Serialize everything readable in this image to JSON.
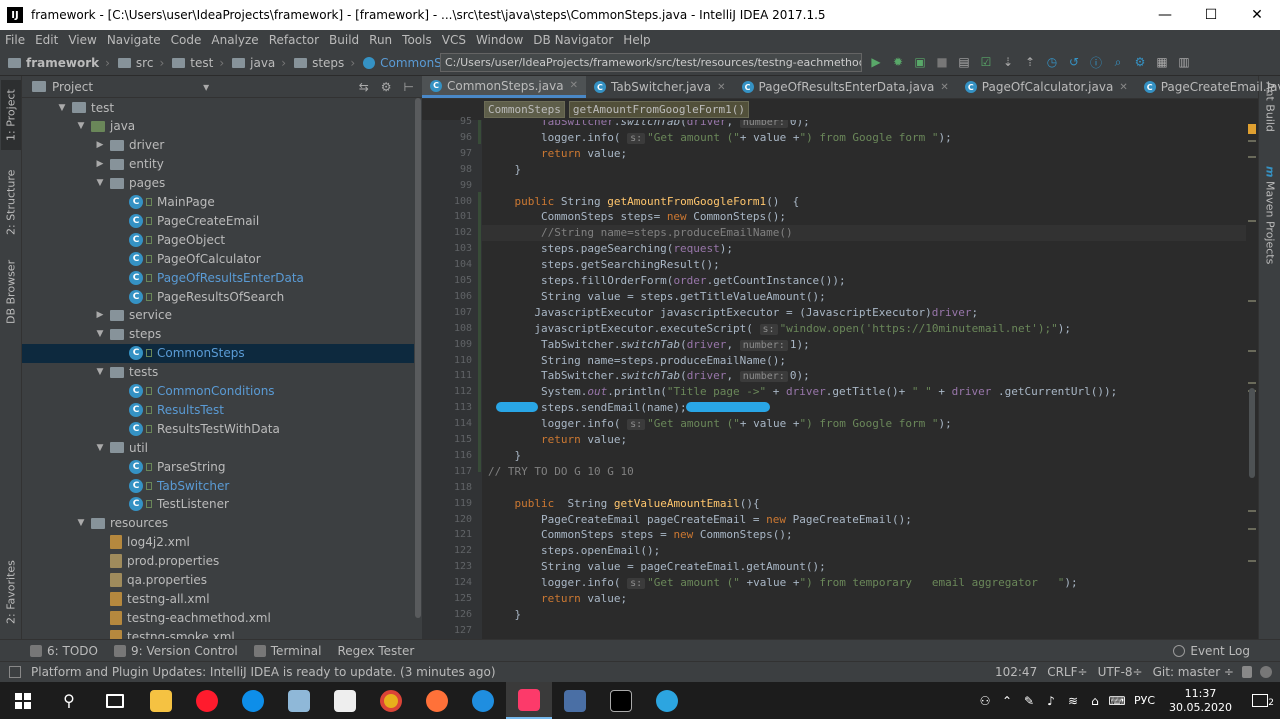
{
  "window": {
    "title": "framework - [C:\\Users\\user\\IdeaProjects\\framework] - [framework] - ...\\src\\test\\java\\steps\\CommonSteps.java - IntelliJ IDEA 2017.1.5",
    "minimize": "—",
    "maximize": "☐",
    "close": "✕"
  },
  "menu": [
    "File",
    "Edit",
    "View",
    "Navigate",
    "Code",
    "Analyze",
    "Refactor",
    "Build",
    "Run",
    "Tools",
    "VCS",
    "Window",
    "DB Navigator",
    "Help"
  ],
  "nav": {
    "crumbs": [
      "framework",
      "src",
      "test",
      "java",
      "steps",
      "CommonSteps"
    ],
    "path": "C:/Users/user/IdeaProjects/framework/src/test/resources/testng-eachmethod.xml",
    "path_arrow": "▾"
  },
  "toolbar_icons": [
    "run-icon",
    "debug-icon",
    "coverage-icon",
    "stop-icon",
    "build-icon",
    "check-icon",
    "commit-icon",
    "vcs-update-icon",
    "history-icon",
    "info-icon",
    "search-icon",
    "settings-icon",
    "module-icon",
    "layout-icon"
  ],
  "side_left": {
    "project": "1: Project",
    "structure": "2: Structure",
    "db": "DB Browser",
    "favorites": "2: Favorites"
  },
  "side_right": {
    "ant": "Ant Build",
    "maven": "Maven Projects",
    "maven_m": "m"
  },
  "project_panel": {
    "title": "Project",
    "dropdown": "▾",
    "icons": [
      "⇆",
      "⚙",
      "⊢"
    ]
  },
  "tree": [
    {
      "label": "test",
      "depth": 2,
      "type": "folder",
      "arrow": "▼"
    },
    {
      "label": "java",
      "depth": 3,
      "type": "srcfolder",
      "arrow": "▼"
    },
    {
      "label": "driver",
      "depth": 4,
      "type": "folder",
      "arrow": "▶"
    },
    {
      "label": "entity",
      "depth": 4,
      "type": "folder",
      "arrow": "▶"
    },
    {
      "label": "pages",
      "depth": 4,
      "type": "folder",
      "arrow": "▼"
    },
    {
      "label": "MainPage",
      "depth": 5,
      "type": "class"
    },
    {
      "label": "PageCreateEmail",
      "depth": 5,
      "type": "class"
    },
    {
      "label": "PageObject",
      "depth": 5,
      "type": "class"
    },
    {
      "label": "PageOfCalculator",
      "depth": 5,
      "type": "class"
    },
    {
      "label": "PageOfResultsEnterData",
      "depth": 5,
      "type": "class",
      "blue": true
    },
    {
      "label": "PageResultsOfSearch",
      "depth": 5,
      "type": "class"
    },
    {
      "label": "service",
      "depth": 4,
      "type": "folder",
      "arrow": "▶"
    },
    {
      "label": "steps",
      "depth": 4,
      "type": "folder",
      "arrow": "▼"
    },
    {
      "label": "CommonSteps",
      "depth": 5,
      "type": "class",
      "blue": true,
      "selected": true
    },
    {
      "label": "tests",
      "depth": 4,
      "type": "folder",
      "arrow": "▼"
    },
    {
      "label": "CommonConditions",
      "depth": 5,
      "type": "class",
      "blue": true
    },
    {
      "label": "ResultsTest",
      "depth": 5,
      "type": "class",
      "blue": true
    },
    {
      "label": "ResultsTestWithData",
      "depth": 5,
      "type": "class"
    },
    {
      "label": "util",
      "depth": 4,
      "type": "folder",
      "arrow": "▼"
    },
    {
      "label": "ParseString",
      "depth": 5,
      "type": "class"
    },
    {
      "label": "TabSwitcher",
      "depth": 5,
      "type": "class",
      "blue": true
    },
    {
      "label": "TestListener",
      "depth": 5,
      "type": "class"
    },
    {
      "label": "resources",
      "depth": 3,
      "type": "folder",
      "arrow": "▼"
    },
    {
      "label": "log4j2.xml",
      "depth": 4,
      "type": "xml"
    },
    {
      "label": "prod.properties",
      "depth": 4,
      "type": "prop"
    },
    {
      "label": "qa.properties",
      "depth": 4,
      "type": "prop"
    },
    {
      "label": "testng-all.xml",
      "depth": 4,
      "type": "xml"
    },
    {
      "label": "testng-eachmethod.xml",
      "depth": 4,
      "type": "xml"
    },
    {
      "label": "testng-smoke.xml",
      "depth": 4,
      "type": "xml"
    }
  ],
  "tabs": [
    {
      "label": "CommonSteps.java",
      "active": true
    },
    {
      "label": "TabSwitcher.java"
    },
    {
      "label": "PageOfResultsEnterData.java"
    },
    {
      "label": "PageOfCalculator.java"
    },
    {
      "label": "PageCreateEmail.java"
    }
  ],
  "tab_close": "✕",
  "tab_overflow": "≡",
  "breadcrumb": [
    "CommonSteps",
    "getAmountFromGoogleForm1()"
  ],
  "code_lines": [
    {
      "n": "95",
      "html": "        <span class='fld'>TabSwitcher</span>.<span class='it'>switchTab</span>(<span class='fld'>driver</span>, <span class='hint'>number:</span>0);"
    },
    {
      "n": "96",
      "html": "        logger.info( <span class='hint'>s:</span><span class='str'>\"Get amount (\"</span>+ value +<span class='str'>\") from Google form \"</span>);"
    },
    {
      "n": "97",
      "html": "        <span class='kw'>return</span> value;"
    },
    {
      "n": "98",
      "html": "    }"
    },
    {
      "n": "99",
      "html": ""
    },
    {
      "n": "100",
      "html": "    <span class='kw'>public</span> String <span class='fn'>getAmountFromGoogleForm1</span>()  {"
    },
    {
      "n": "101",
      "html": "        CommonSteps steps= <span class='kw'>new</span> CommonSteps();"
    },
    {
      "n": "102",
      "html": "        <span class='cm'>//String name=steps.produceEmailName()</span>",
      "hl": true
    },
    {
      "n": "103",
      "html": "        steps.pageSearching(<span class='fld'>request</span>);"
    },
    {
      "n": "104",
      "html": "        steps.getSearchingResult();"
    },
    {
      "n": "105",
      "html": "        steps.fillOrderForm(<span class='fld'>order</span>.getCountInstance());"
    },
    {
      "n": "106",
      "html": "        String value = steps.getTitleValueAmount();"
    },
    {
      "n": "107",
      "html": "       JavascriptExecutor javascriptExecutor = (JavascriptExecutor)<span class='fld'>driver</span>;"
    },
    {
      "n": "108",
      "html": "       javascriptExecutor.executeScript( <span class='hint'>s:</span><span class='str'>\"window.open('https://10minutemail.net');\"</span>);"
    },
    {
      "n": "109",
      "html": "        TabSwitcher.<span class='it'>switchTab</span>(<span class='fld'>driver</span>, <span class='hint'>number:</span>1);"
    },
    {
      "n": "110",
      "html": "        String name=steps.produceEmailName();"
    },
    {
      "n": "111",
      "html": "        TabSwitcher.<span class='it'>switchTab</span>(<span class='fld'>driver</span>, <span class='hint'>number:</span>0);"
    },
    {
      "n": "112",
      "html": "        System.<span class='fld it'>out</span>.println(<span class='str'>\"Title page ->\"</span> + <span class='fld'>driver</span>.getTitle()+ <span class='str'>\" \"</span> + <span class='fld'>driver</span> .getCurrentUrl());"
    },
    {
      "n": "113",
      "html": "        steps.sendEmail(name);"
    },
    {
      "n": "114",
      "html": "        logger.info( <span class='hint'>s:</span><span class='str'>\"Get amount (\"</span>+ value +<span class='str'>\") from Google form \"</span>);"
    },
    {
      "n": "115",
      "html": "        <span class='kw'>return</span> value;"
    },
    {
      "n": "116",
      "html": "    }"
    },
    {
      "n": "117",
      "html": "<span class='cm'>// TRY TO DO G 10 G 10</span>"
    },
    {
      "n": "118",
      "html": ""
    },
    {
      "n": "119",
      "html": "    <span class='kw'>public</span>  String <span class='fn'>getValueAmountEmail</span>(){"
    },
    {
      "n": "120",
      "html": "        PageCreateEmail pageCreateEmail = <span class='kw'>new</span> PageCreateEmail();"
    },
    {
      "n": "121",
      "html": "        CommonSteps steps = <span class='kw'>new</span> CommonSteps();"
    },
    {
      "n": "122",
      "html": "        steps.openEmail();"
    },
    {
      "n": "123",
      "html": "        String value = pageCreateEmail.getAmount();"
    },
    {
      "n": "124",
      "html": "        logger.info( <span class='hint'>s:</span><span class='str'>\"Get amount (\"</span> +value +<span class='str'>\") from temporary   email aggregator   \"</span>);"
    },
    {
      "n": "125",
      "html": "        <span class='kw'>return</span> value;"
    },
    {
      "n": "126",
      "html": "    }"
    },
    {
      "n": "127",
      "html": ""
    }
  ],
  "toolwindows": [
    {
      "label": "6: TODO",
      "icon": "todo-icon"
    },
    {
      "label": "9: Version Control",
      "icon": "vcs-icon"
    },
    {
      "label": "Terminal",
      "icon": "terminal-icon"
    },
    {
      "label": "Regex Tester",
      "icon": ""
    }
  ],
  "eventlog": "Event Log",
  "status": {
    "message": "Platform and Plugin Updates: IntelliJ IDEA is ready to update. (3 minutes ago)",
    "position": "102:47",
    "crlf": "CRLF÷",
    "encoding": "UTF-8÷",
    "git": "Git: master ÷"
  },
  "taskbar": {
    "lang": "РУС",
    "time": "11:37",
    "date": "30.05.2020",
    "notif": "2"
  },
  "colors": {
    "accent": "#4a88c7",
    "selection": "#0d293e",
    "annotation": "#29a6e6"
  }
}
